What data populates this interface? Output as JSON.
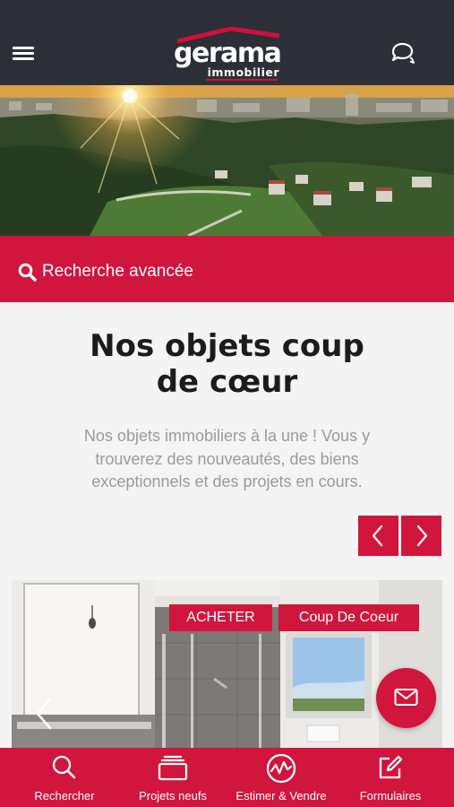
{
  "header": {
    "logo_word": "gerama",
    "logo_sub": "immobilier",
    "menu_icon": "hamburger-menu-icon",
    "chat_icon": "chat-bubbles-icon"
  },
  "search": {
    "label": "Recherche avancée",
    "icon": "search-icon"
  },
  "section": {
    "title_line1": "Nos objets coup",
    "title_line2": "de cœur",
    "description": "Nos objets immobiliers à la une ! Vous y trouverez des nouveautés, des biens exceptionnels et des projets en cours."
  },
  "carousel": {
    "prev_icon": "chevron-left-icon",
    "next_icon": "chevron-right-icon"
  },
  "card": {
    "badge_buy": "ACHETER",
    "badge_fav": "Coup De Coeur"
  },
  "fab": {
    "icon": "mail-icon"
  },
  "bottom_nav": {
    "items": [
      {
        "label": "Rechercher",
        "icon": "search-icon"
      },
      {
        "label": "Projets neufs",
        "icon": "stack-icon"
      },
      {
        "label": "Estimer & Vendre",
        "icon": "chart-circle-icon"
      },
      {
        "label": "Formulaires",
        "icon": "edit-form-icon"
      }
    ]
  },
  "colors": {
    "brand_red": "#d0163c",
    "header_dark": "#2c2f37"
  }
}
